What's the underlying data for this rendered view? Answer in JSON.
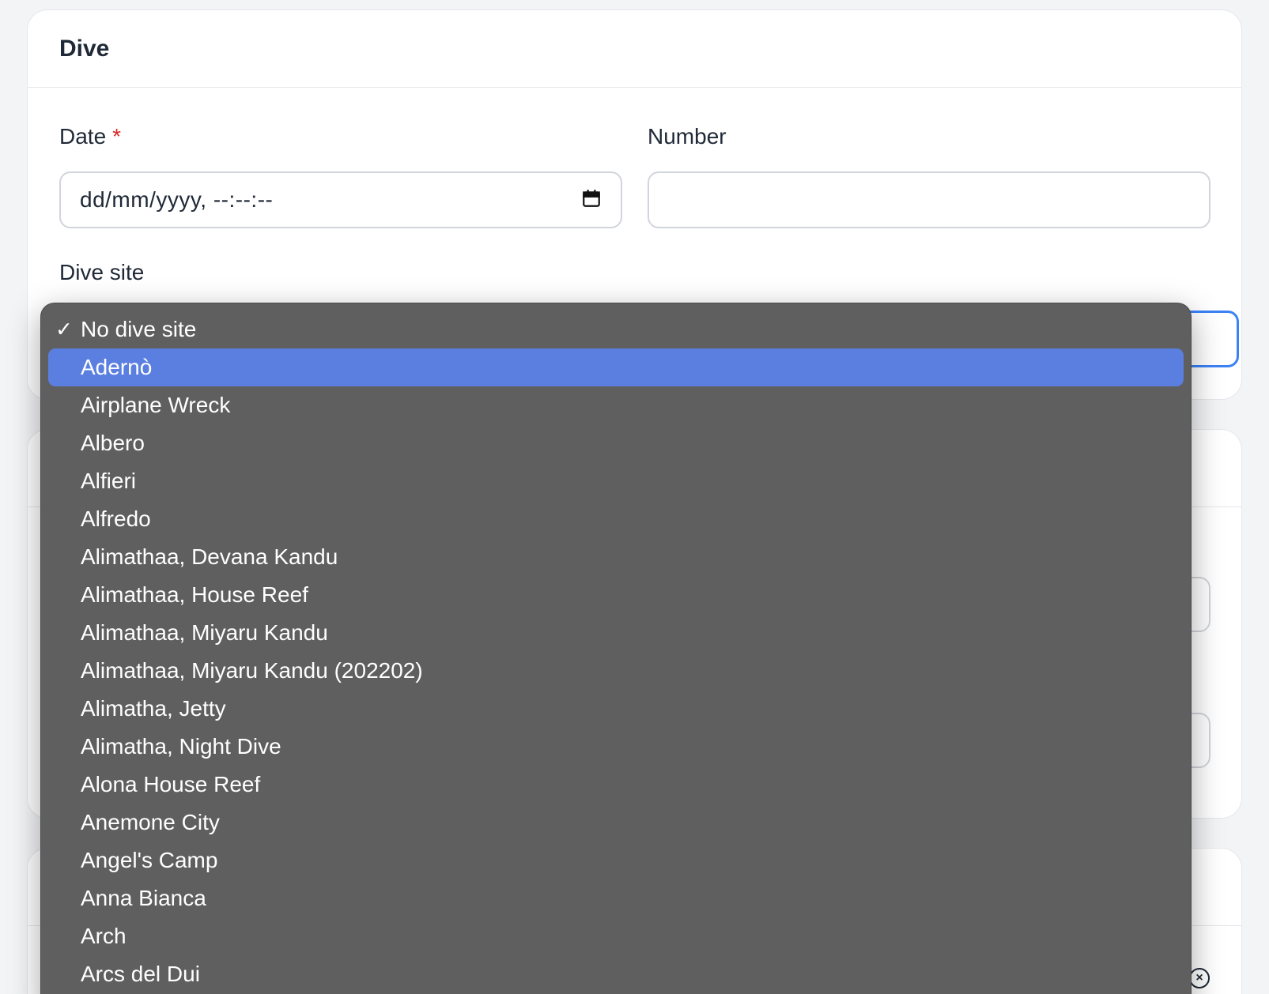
{
  "card": {
    "title": "Dive"
  },
  "fields": {
    "date_label": "Date",
    "date_required_mark": "*",
    "date_value": "dd/mm/yyyy, --:--:--",
    "number_label": "Number",
    "number_value": "",
    "dive_site_label": "Dive site"
  },
  "dropdown": {
    "checkmark": "✓",
    "options": [
      "No dive site",
      "Adernò",
      "Airplane Wreck",
      "Albero",
      "Alfieri",
      "Alfredo",
      "Alimathaa, Devana Kandu",
      "Alimathaa, House Reef",
      "Alimathaa, Miyaru Kandu",
      "Alimathaa, Miyaru Kandu (202202)",
      "Alimatha, Jetty",
      "Alimatha, Night Dive",
      "Alona House Reef",
      "Anemone City",
      "Angel's Camp",
      "Anna Bianca",
      "Arch",
      "Arcs del Dui"
    ],
    "checked_index": 0,
    "highlighted_index": 1,
    "highlight_color": "#5b7fe0"
  },
  "icons": {
    "calendar": "calendar-icon",
    "close": "close-circle-icon"
  },
  "colors": {
    "required": "#dc2626",
    "focus_border": "#3b82f6",
    "dropdown_bg": "#5f5f5f"
  }
}
